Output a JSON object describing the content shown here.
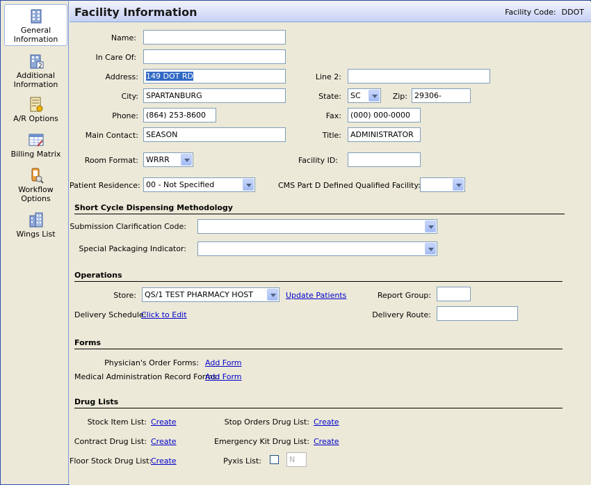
{
  "sidebar": {
    "items": [
      {
        "label_line1": "General",
        "label_line2": "Information",
        "icon": "building-icon",
        "active": true
      },
      {
        "label_line1": "Additional",
        "label_line2": "Information",
        "icon": "building-two-icon"
      },
      {
        "label_line1": "A/R Options",
        "label_line2": "",
        "icon": "ledger-icon"
      },
      {
        "label_line1": "Billing Matrix",
        "label_line2": "",
        "icon": "matrix-icon"
      },
      {
        "label_line1": "Workflow",
        "label_line2": "Options",
        "icon": "workflow-icon"
      },
      {
        "label_line1": "Wings List",
        "label_line2": "",
        "icon": "wings-building-icon"
      }
    ]
  },
  "header": {
    "title": "Facility Information",
    "facility_code_label": "Facility Code:",
    "facility_code": "DDOT"
  },
  "form": {
    "name_label": "Name:",
    "name_value": "",
    "in_care_of_label": "In Care Of:",
    "in_care_of_value": "",
    "address_label": "Address:",
    "address_value": "149 DOT RD",
    "line2_label": "Line 2:",
    "line2_value": "",
    "city_label": "City:",
    "city_value": "SPARTANBURG",
    "state_label": "State:",
    "state_value": "SC",
    "zip_label": "Zip:",
    "zip_value": "29306-",
    "phone_label": "Phone:",
    "phone_value": "(864) 253-8600",
    "fax_label": "Fax:",
    "fax_value": "(000) 000-0000",
    "main_contact_label": "Main Contact:",
    "main_contact_value": "SEASON",
    "title_label": "Title:",
    "title_value": "ADMINISTRATOR",
    "room_format_label": "Room Format:",
    "room_format_value": "WRRR",
    "facility_id_label": "Facility ID:",
    "facility_id_value": "",
    "patient_residence_label": "Patient Residence:",
    "patient_residence_value": "00 - Not Specified",
    "cms_label": "CMS Part D Defined Qualified Facility:",
    "cms_value": ""
  },
  "short_cycle": {
    "heading": "Short Cycle Dispensing Methodology",
    "submission_label": "Submission Clarification Code:",
    "submission_value": "",
    "packaging_label": "Special Packaging Indicator:",
    "packaging_value": ""
  },
  "operations": {
    "heading": "Operations",
    "store_label": "Store:",
    "store_value": "QS/1 TEST PHARMACY HOST",
    "update_patients_link": "Update Patients",
    "report_group_label": "Report Group:",
    "report_group_value": "",
    "delivery_schedule_label": "Delivery Schedule:",
    "delivery_schedule_link": "Click to Edit",
    "delivery_route_label": "Delivery Route:",
    "delivery_route_value": ""
  },
  "forms": {
    "heading": "Forms",
    "physician_label": "Physician's Order Forms:",
    "physician_link": "Add Form",
    "mar_label": "Medical Administration Record Forms:",
    "mar_link": "Add Form"
  },
  "drug_lists": {
    "heading": "Drug Lists",
    "stock_item_label": "Stock Item List:",
    "stock_item_link": "Create",
    "contract_label": "Contract Drug List:",
    "contract_link": "Create",
    "floor_stock_label": "Floor Stock Drug List:",
    "floor_stock_link": "Create",
    "stop_orders_label": "Stop Orders Drug List:",
    "stop_orders_link": "Create",
    "emergency_kit_label": "Emergency Kit Drug List:",
    "emergency_kit_link": "Create",
    "pyxis_label": "Pyxis List:",
    "pyxis_value": "N"
  },
  "colors": {
    "link": "#0000cc",
    "selection": "#316ac5",
    "header_gradient_end": "#c5d0f4"
  }
}
